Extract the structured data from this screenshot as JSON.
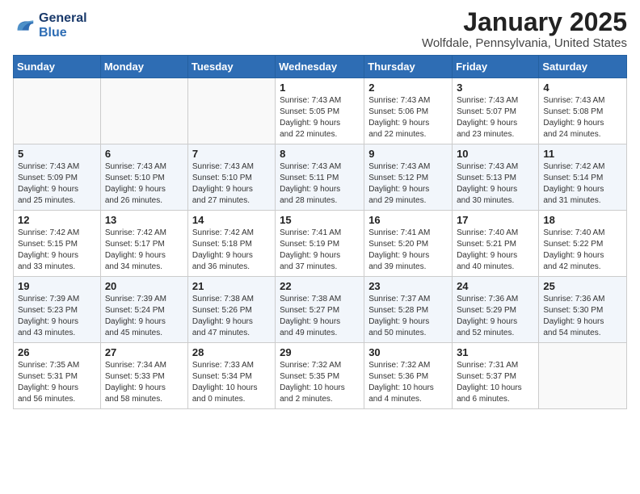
{
  "header": {
    "logo_line1": "General",
    "logo_line2": "Blue",
    "title": "January 2025",
    "subtitle": "Wolfdale, Pennsylvania, United States"
  },
  "days_of_week": [
    "Sunday",
    "Monday",
    "Tuesday",
    "Wednesday",
    "Thursday",
    "Friday",
    "Saturday"
  ],
  "weeks": [
    [
      {
        "day": "",
        "info": ""
      },
      {
        "day": "",
        "info": ""
      },
      {
        "day": "",
        "info": ""
      },
      {
        "day": "1",
        "info": "Sunrise: 7:43 AM\nSunset: 5:05 PM\nDaylight: 9 hours\nand 22 minutes."
      },
      {
        "day": "2",
        "info": "Sunrise: 7:43 AM\nSunset: 5:06 PM\nDaylight: 9 hours\nand 22 minutes."
      },
      {
        "day": "3",
        "info": "Sunrise: 7:43 AM\nSunset: 5:07 PM\nDaylight: 9 hours\nand 23 minutes."
      },
      {
        "day": "4",
        "info": "Sunrise: 7:43 AM\nSunset: 5:08 PM\nDaylight: 9 hours\nand 24 minutes."
      }
    ],
    [
      {
        "day": "5",
        "info": "Sunrise: 7:43 AM\nSunset: 5:09 PM\nDaylight: 9 hours\nand 25 minutes."
      },
      {
        "day": "6",
        "info": "Sunrise: 7:43 AM\nSunset: 5:10 PM\nDaylight: 9 hours\nand 26 minutes."
      },
      {
        "day": "7",
        "info": "Sunrise: 7:43 AM\nSunset: 5:10 PM\nDaylight: 9 hours\nand 27 minutes."
      },
      {
        "day": "8",
        "info": "Sunrise: 7:43 AM\nSunset: 5:11 PM\nDaylight: 9 hours\nand 28 minutes."
      },
      {
        "day": "9",
        "info": "Sunrise: 7:43 AM\nSunset: 5:12 PM\nDaylight: 9 hours\nand 29 minutes."
      },
      {
        "day": "10",
        "info": "Sunrise: 7:43 AM\nSunset: 5:13 PM\nDaylight: 9 hours\nand 30 minutes."
      },
      {
        "day": "11",
        "info": "Sunrise: 7:42 AM\nSunset: 5:14 PM\nDaylight: 9 hours\nand 31 minutes."
      }
    ],
    [
      {
        "day": "12",
        "info": "Sunrise: 7:42 AM\nSunset: 5:15 PM\nDaylight: 9 hours\nand 33 minutes."
      },
      {
        "day": "13",
        "info": "Sunrise: 7:42 AM\nSunset: 5:17 PM\nDaylight: 9 hours\nand 34 minutes."
      },
      {
        "day": "14",
        "info": "Sunrise: 7:42 AM\nSunset: 5:18 PM\nDaylight: 9 hours\nand 36 minutes."
      },
      {
        "day": "15",
        "info": "Sunrise: 7:41 AM\nSunset: 5:19 PM\nDaylight: 9 hours\nand 37 minutes."
      },
      {
        "day": "16",
        "info": "Sunrise: 7:41 AM\nSunset: 5:20 PM\nDaylight: 9 hours\nand 39 minutes."
      },
      {
        "day": "17",
        "info": "Sunrise: 7:40 AM\nSunset: 5:21 PM\nDaylight: 9 hours\nand 40 minutes."
      },
      {
        "day": "18",
        "info": "Sunrise: 7:40 AM\nSunset: 5:22 PM\nDaylight: 9 hours\nand 42 minutes."
      }
    ],
    [
      {
        "day": "19",
        "info": "Sunrise: 7:39 AM\nSunset: 5:23 PM\nDaylight: 9 hours\nand 43 minutes."
      },
      {
        "day": "20",
        "info": "Sunrise: 7:39 AM\nSunset: 5:24 PM\nDaylight: 9 hours\nand 45 minutes."
      },
      {
        "day": "21",
        "info": "Sunrise: 7:38 AM\nSunset: 5:26 PM\nDaylight: 9 hours\nand 47 minutes."
      },
      {
        "day": "22",
        "info": "Sunrise: 7:38 AM\nSunset: 5:27 PM\nDaylight: 9 hours\nand 49 minutes."
      },
      {
        "day": "23",
        "info": "Sunrise: 7:37 AM\nSunset: 5:28 PM\nDaylight: 9 hours\nand 50 minutes."
      },
      {
        "day": "24",
        "info": "Sunrise: 7:36 AM\nSunset: 5:29 PM\nDaylight: 9 hours\nand 52 minutes."
      },
      {
        "day": "25",
        "info": "Sunrise: 7:36 AM\nSunset: 5:30 PM\nDaylight: 9 hours\nand 54 minutes."
      }
    ],
    [
      {
        "day": "26",
        "info": "Sunrise: 7:35 AM\nSunset: 5:31 PM\nDaylight: 9 hours\nand 56 minutes."
      },
      {
        "day": "27",
        "info": "Sunrise: 7:34 AM\nSunset: 5:33 PM\nDaylight: 9 hours\nand 58 minutes."
      },
      {
        "day": "28",
        "info": "Sunrise: 7:33 AM\nSunset: 5:34 PM\nDaylight: 10 hours\nand 0 minutes."
      },
      {
        "day": "29",
        "info": "Sunrise: 7:32 AM\nSunset: 5:35 PM\nDaylight: 10 hours\nand 2 minutes."
      },
      {
        "day": "30",
        "info": "Sunrise: 7:32 AM\nSunset: 5:36 PM\nDaylight: 10 hours\nand 4 minutes."
      },
      {
        "day": "31",
        "info": "Sunrise: 7:31 AM\nSunset: 5:37 PM\nDaylight: 10 hours\nand 6 minutes."
      },
      {
        "day": "",
        "info": ""
      }
    ]
  ]
}
